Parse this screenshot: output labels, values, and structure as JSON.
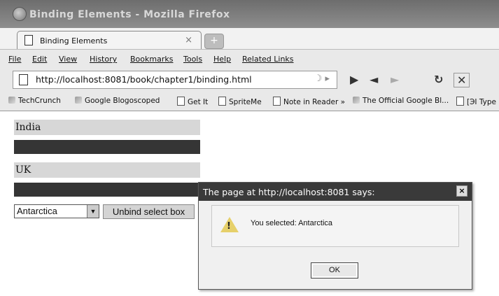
{
  "window": {
    "title": "Binding Elements - Mozilla Firefox"
  },
  "tab": {
    "label": "Binding Elements",
    "close": "×",
    "new_tab": "+"
  },
  "menu": [
    "File",
    "Edit",
    "View",
    "History",
    "Bookmarks",
    "Tools",
    "Help",
    "Related Links"
  ],
  "nav": {
    "url": "http://localhost:8081/book/chapter1/binding.html"
  },
  "bookmarks": [
    "TechCrunch",
    "Google Blogoscoped",
    "Get It",
    "SpriteMe",
    "Note in Reader »",
    "The Official Google Bl...",
    "[ЭI Type"
  ],
  "page": {
    "items": [
      "India",
      "UK"
    ],
    "select_value": "Antarctica",
    "unbind_label": "Unbind select box"
  },
  "dialog": {
    "title": "The page at http://localhost:8081 says:",
    "message": "You selected: Antarctica",
    "ok_label": "OK",
    "close": "×"
  }
}
